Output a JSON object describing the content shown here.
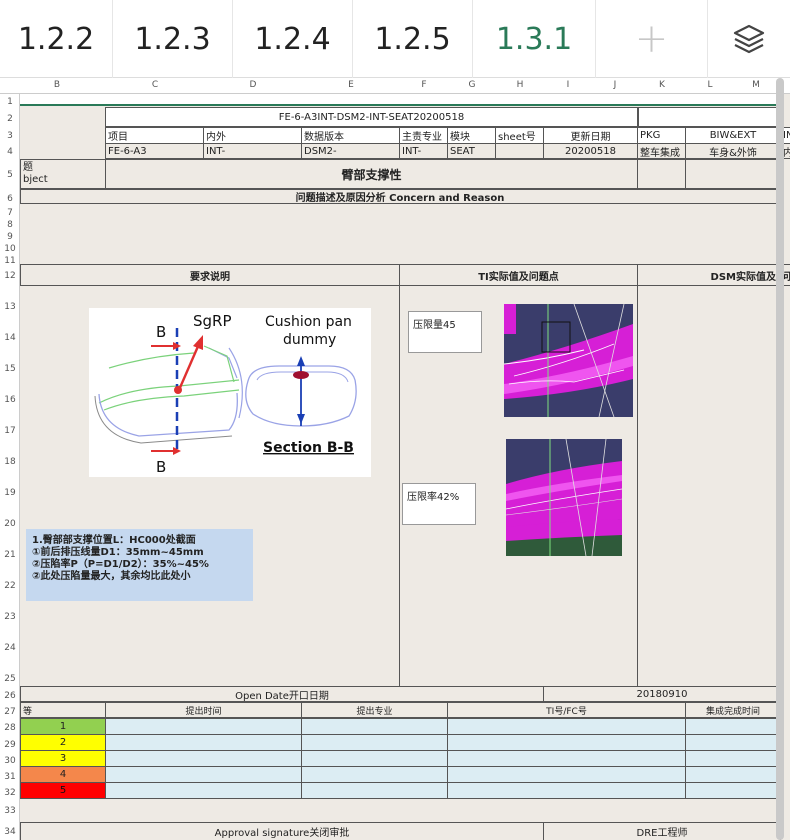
{
  "tabs": [
    {
      "label": "1.2.2"
    },
    {
      "label": "1.2.3"
    },
    {
      "label": "1.2.4"
    },
    {
      "label": "1.2.5"
    },
    {
      "label": "1.3.1",
      "active": true
    }
  ],
  "icons": {
    "add_tab": "plus-icon",
    "layers": "layers-icon"
  },
  "columns": [
    "B",
    "C",
    "D",
    "E",
    "F",
    "G",
    "H",
    "I",
    "J",
    "K",
    "L",
    "M"
  ],
  "rows": [
    "1",
    "2",
    "3",
    "4",
    "5",
    "6",
    "7",
    "8",
    "9",
    "10",
    "11",
    "12",
    "13",
    "14",
    "15",
    "16",
    "17",
    "18",
    "19",
    "20",
    "21",
    "22",
    "23",
    "24",
    "25",
    "26",
    "27",
    "28",
    "29",
    "30",
    "31",
    "32",
    "33",
    "34"
  ],
  "doc": {
    "title_code": "FE-6-A3INT-DSM2-INT-SEAT20200518",
    "headers": {
      "project": "项目",
      "inout": "内外",
      "data_version": "数据版本",
      "owner": "主责专业",
      "module": "模块",
      "sheet_no": "sheet号",
      "update_date": "更新日期",
      "pkg": "PKG",
      "biw": "BIW&EXT",
      "cut": "IN"
    },
    "values": {
      "project": "FE-6-A3",
      "inout": "INT-",
      "data_version": "DSM2-",
      "owner": "INT-",
      "module": "SEAT",
      "sheet_no": "",
      "update_date": "20200518",
      "pkg": "整车集成",
      "biw": "车身&外饰",
      "cut": "内"
    },
    "subject_label_1": "题",
    "subject_label_2": "bject",
    "subject_title": "臂部支撑性",
    "concern_header": "问题描述及原因分析 Concern and Reason",
    "req_header": "要求说明",
    "ti_header": "TI实际值及问题点",
    "dsm_header": "DSM实际值及",
    "dsm_header_cut": "问题",
    "diagram_labels": {
      "b_top": "B",
      "b_bottom": "B",
      "sgrp": "SgRP",
      "cushion": "Cushion pan",
      "dummy": "dummy",
      "section": "Section B-B"
    },
    "note_text": "1.臀部部支撑位置L：HC000处截面\n①前后排压线量D1：35mm~45mm\n②压陷率P（P=D1/D2）：35%~45%\n②此处压陷量最大，其余均比此处小",
    "ti_box_1": "压限量45",
    "ti_box_2": "压限率42%",
    "open_date_label": "Open Date开口日期",
    "open_date_value": "20180910",
    "risk_header_cut": "等",
    "risk_cols": {
      "raised_time": "提出时间",
      "raised_dept": "提出专业",
      "ti_fc": "TI号/FC号",
      "done_time": "集成完成时间"
    },
    "risk_levels": [
      {
        "label": "1",
        "color": "#92d050"
      },
      {
        "label": "2",
        "color": "#ffff00"
      },
      {
        "label": "3",
        "color": "#ffff00"
      },
      {
        "label": "4",
        "color": "#f4874b"
      },
      {
        "label": "5",
        "color": "#ff0000"
      }
    ],
    "approval_label": "Approval signature关闭审批",
    "dre_label": "DRE工程师"
  }
}
